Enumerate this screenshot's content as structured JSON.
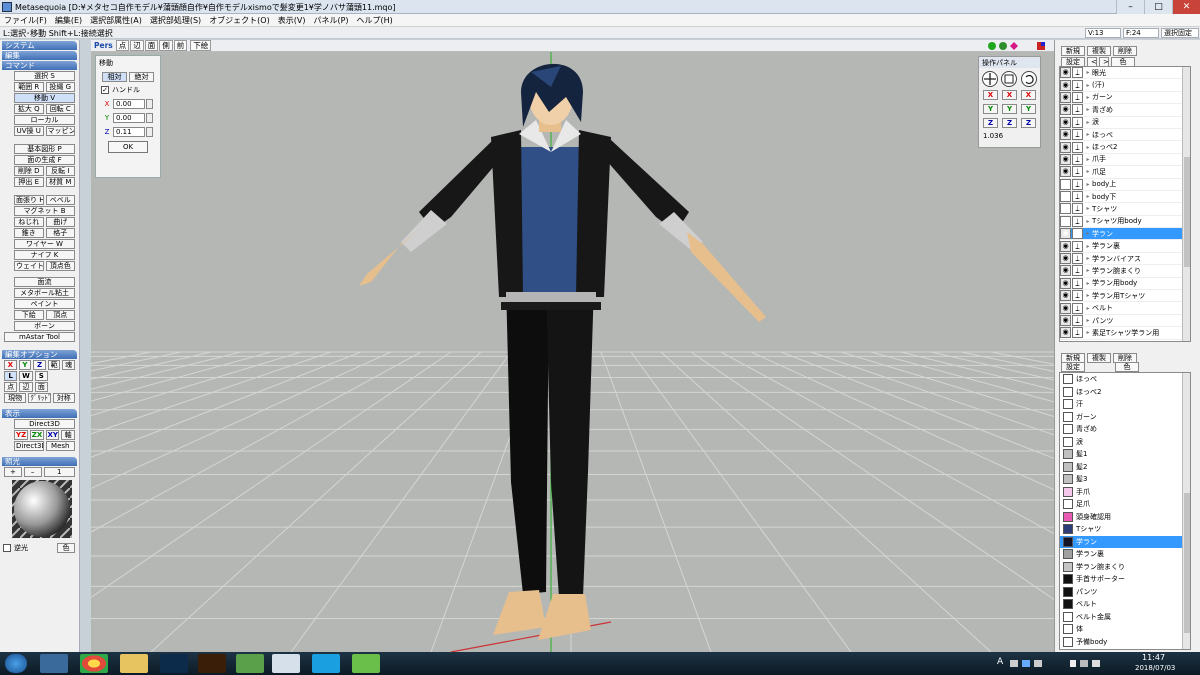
{
  "title": "Metasequoia [D:¥メタセコ自作モデル¥蒲頭顔自作¥自作モデルxismoで髪変更1¥学ノバサ蒲頭11.mqo]",
  "window_controls": [
    "–",
    "□",
    "✕"
  ],
  "menu": [
    "ファイル(F)",
    "編集(E)",
    "選択部属性(A)",
    "選択部処理(S)",
    "オブジェクト(O)",
    "表示(V)",
    "パネル(P)",
    "ヘルプ(H)"
  ],
  "status": {
    "hint": "L:選択･移動  Shift+L:接続選択",
    "v": "V:13",
    "f": "F:24",
    "mode": "選択固定"
  },
  "left": {
    "sections": {
      "system": "システム",
      "edit": "編集",
      "command": "コマンド",
      "edit_opt": "編集オプション",
      "display": "表示",
      "light": "照光"
    },
    "cmd1": [
      "選択 S",
      "範囲 R",
      "投縄 G",
      "移動 V",
      "拡大 Q",
      "回転 C",
      "ローカル",
      "UV操 U",
      "マッピング"
    ],
    "cmd2": [
      "基本図形 P",
      "面の生成 F",
      "削除 D",
      "反転 I",
      "押出 E",
      "材質 M"
    ],
    "cmd3": [
      "面張り H",
      "ベベル",
      "マグネット B",
      "ねじれ",
      "曲げ",
      "錐き",
      "格子",
      "ワイヤー W",
      "ナイフ K",
      "ウェイト",
      "頂点色"
    ],
    "cmd4": [
      "面流",
      "メタボール粘土",
      "ペイント",
      "下絵",
      "頂点",
      "ボーン",
      "mAstar Tool"
    ],
    "opt_axes": [
      "X",
      "Y",
      "Z",
      "範",
      "魂"
    ],
    "opt_lws": [
      "L",
      "W",
      "S"
    ],
    "opt_sel": [
      "点",
      "辺",
      "面"
    ],
    "opt_misc": [
      "現物",
      "ｸﾞﾘｯﾄﾞ",
      "対称"
    ],
    "disp": [
      "Direct3D",
      "YZ",
      "ZX",
      "XY",
      "軸",
      "Direct3D",
      "Mesh"
    ],
    "light_ctrls": [
      "+",
      "–",
      "1"
    ],
    "light_rev": "逆光",
    "light_color": "色"
  },
  "viewtoolbar": [
    "Pers",
    "点",
    "辺",
    "面",
    "側",
    "前",
    "下絵"
  ],
  "move_panel": {
    "title": "移動",
    "rel": "相対",
    "abs": "絶対",
    "handle": "ハンドル",
    "x_label": "X",
    "y_label": "Y",
    "z_label": "Z",
    "x": "0.00",
    "y": "0.00",
    "z": "0.11",
    "ok": "OK"
  },
  "ops_panel": {
    "title": "操作パネル",
    "value": "1.036",
    "axes": [
      "X",
      "Y",
      "Z"
    ]
  },
  "obj_toolbar": [
    "新規",
    "複製",
    "削除",
    "設定",
    "<",
    ">",
    "色"
  ],
  "objects": [
    "眼光",
    "(汗)",
    "ガーン",
    "青ざめ",
    "涙",
    "ほっぺ",
    "ほっぺ2",
    "爪手",
    "爪足",
    "body上",
    "body下",
    "Tシャツ",
    "Tシャツ用body",
    "学ラン",
    "学ラン裏",
    "学ランバイアス",
    "学ラン腕まくり",
    "学ラン用body",
    "学ラン用Tシャツ",
    "ベルト",
    "パンツ",
    "素足Tシャツ学ラン用"
  ],
  "objects_visible": [
    true,
    true,
    true,
    true,
    true,
    true,
    true,
    true,
    true,
    false,
    false,
    false,
    false,
    true,
    true,
    true,
    true,
    true,
    true,
    true,
    true,
    true
  ],
  "objects_selected": 13,
  "mat_toolbar": [
    "新規",
    "複製",
    "削除",
    "設定",
    "色"
  ],
  "materials": [
    "ほっぺ",
    "ほっぺ2",
    "汗",
    "ガーン",
    "青ざめ",
    "涙",
    "髪1",
    "髪2",
    "髪3",
    "手爪",
    "足爪",
    "頭身確認用",
    "Tシャツ",
    "学ラン",
    "学ラン裏",
    "学ラン腕まくり",
    "手首サポーター",
    "パンツ",
    "ベルト",
    "ベルト金属",
    "体",
    "予備body"
  ],
  "material_colors": [
    "#ffffff",
    "#ffffff",
    "#ffffff",
    "#ffffff",
    "#ffffff",
    "#ffffff",
    "#bfbfbf",
    "#bfbfbf",
    "#bfbfbf",
    "#f6c8ec",
    "#ffffff",
    "#e85ab4",
    "#2c3d78",
    "#141428",
    "#a0a0a0",
    "#c4c4c4",
    "#111111",
    "#111111",
    "#111111",
    "#ffffff",
    "#ffffff",
    "#ffffff"
  ],
  "materials_selected": 13,
  "taskbar": {
    "time": "11:47",
    "date": "2018/07/03",
    "ime": "A"
  }
}
